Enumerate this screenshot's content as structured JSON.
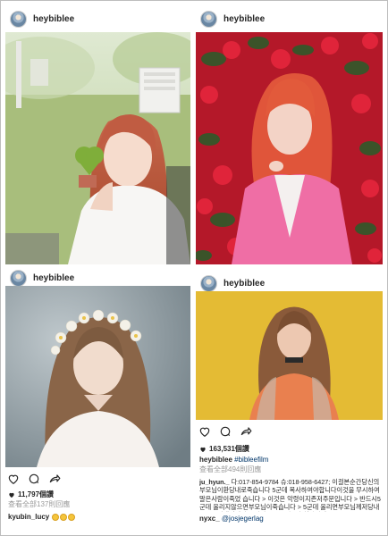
{
  "posts": [
    {
      "username": "heybiblee"
    },
    {
      "username": "heybiblee"
    },
    {
      "username": "heybiblee",
      "likes": "11,797個讚",
      "view_comments": "查看全部137則回應",
      "comment_user": "kyubin_lucy"
    },
    {
      "username": "heybiblee",
      "likes": "163,531個讚",
      "caption_tag": "#bibleefilm",
      "view_comments": "查看全部494則回應",
      "comment_user": "ju_hyun._",
      "comment_text": "다:017-854-9784 슈:018-958-6427; 이걸본순간당신의부모님이환당내로죽습니다 5군데 복사하여야합니다이것을 무시하여말은사람이죽었 습니다 > 이것은 악령이지존저주문입니다 > 반드시5군데 올리지않으면부모님이죽습니다 > 5군데 올리면부모님께저당내로좋을이생깁니다 > 이것 을무시하고후회하지말 [...]",
      "comment2_user": "nyxc_",
      "comment2_mention": "@josjegerlag"
    }
  ],
  "colors": {
    "text": "#262626",
    "secondary_text": "#999999",
    "link": "#003569",
    "border": "#bdbdbd"
  },
  "icons": [
    "heart-icon",
    "comment-icon",
    "share-icon",
    "smile-emoji-icon"
  ]
}
